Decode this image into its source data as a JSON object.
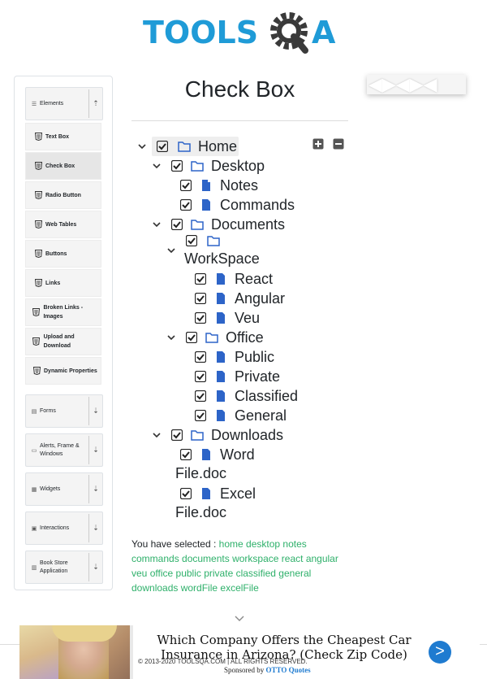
{
  "logo": {
    "text_left": "TOOLS",
    "text_right": "A"
  },
  "sidebar": {
    "groups": [
      {
        "label": "Elements",
        "toggle": "up"
      },
      {
        "label": "Forms",
        "toggle": "down"
      },
      {
        "label": "Alerts, Frame & Windows",
        "toggle": "down"
      },
      {
        "label": "Widgets",
        "toggle": "down"
      },
      {
        "label": "Interactions",
        "toggle": "down"
      },
      {
        "label": "Book Store Application",
        "toggle": "down"
      }
    ],
    "items": [
      {
        "label": "Text Box"
      },
      {
        "label": "Check Box"
      },
      {
        "label": "Radio Button"
      },
      {
        "label": "Web Tables"
      },
      {
        "label": "Buttons"
      },
      {
        "label": "Links"
      },
      {
        "label": "Broken Links - Images"
      },
      {
        "label": "Upload and Download"
      },
      {
        "label": "Dynamic Properties"
      }
    ]
  },
  "main": {
    "title": "Check Box",
    "tree": {
      "home": "Home",
      "desktop": "Desktop",
      "notes": "Notes",
      "commands": "Commands",
      "documents": "Documents",
      "workspace": "WorkSpace",
      "react": "React",
      "angular": "Angular",
      "veu": "Veu",
      "office": "Office",
      "public": "Public",
      "private": "Private",
      "classified": "Classified",
      "general": "General",
      "downloads": "Downloads",
      "wordfile_a": "Word",
      "wordfile_b": "File.doc",
      "excelfile_a": "Excel",
      "excelfile_b": "File.doc"
    },
    "result": {
      "prefix": "You have selected :",
      "items": [
        "home",
        "desktop",
        "notes",
        "commands",
        "documents",
        "workspace",
        "react",
        "angular",
        "veu",
        "office",
        "public",
        "private",
        "classified",
        "general",
        "downloads",
        "wordFile",
        "excelFile"
      ]
    }
  },
  "ad": {
    "top_glyphs": "◀▶◀▶◀",
    "headline": "Which Company Offers the Cheapest Car Insurance in Arizona? (Check Zip Code)",
    "sponsor_prefix": "Sponsored by",
    "sponsor_name": "OTTO Quotes",
    "go": ">"
  },
  "footer": {
    "text": "© 2013-2020 TOOLSQA.COM | ALL RIGHTS RESERVED."
  },
  "colors": {
    "brand": "#1f9bd7",
    "selected_text": "#2eb06a"
  }
}
